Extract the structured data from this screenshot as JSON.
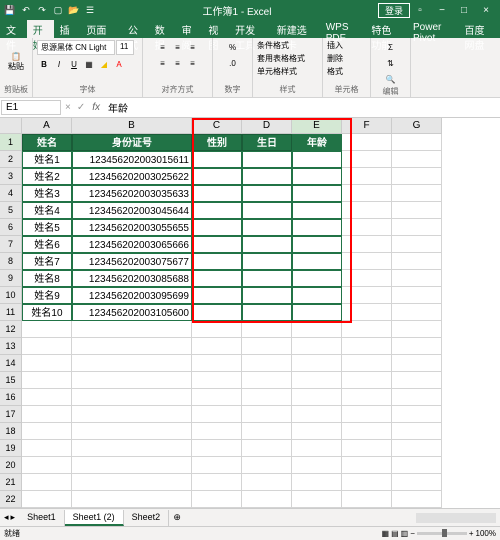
{
  "titlebar": {
    "title": "工作簿1 - Excel",
    "login": "登录",
    "qat": [
      "save-icon",
      "undo-icon",
      "redo-icon",
      "new-icon",
      "open-icon",
      "touch-icon"
    ]
  },
  "tabs": [
    "文件",
    "开始",
    "插入",
    "页面布局",
    "公式",
    "数据",
    "审阅",
    "视图",
    "开发工具",
    "新建选项卡",
    "WPS PDF",
    "特色功能",
    "Power Pivot",
    "百度网盘"
  ],
  "activeTab": 1,
  "ribbon": {
    "clipboard": {
      "label": "剪贴板",
      "paste": "粘贴"
    },
    "font": {
      "label": "字体",
      "name": "思源黑体 CN Light",
      "size": "11"
    },
    "align": {
      "label": "对齐方式"
    },
    "number": {
      "label": "数字"
    },
    "styles": {
      "label": "样式",
      "cond": "条件格式",
      "tbl": "套用表格格式",
      "cell": "单元格样式"
    },
    "cells": {
      "label": "单元格",
      "ins": "插入",
      "del": "删除",
      "fmt": "格式"
    },
    "edit": {
      "label": "编辑"
    }
  },
  "namebox": "E1",
  "formula": "年龄",
  "columns": [
    "A",
    "B",
    "C",
    "D",
    "E",
    "F",
    "G"
  ],
  "headers": {
    "A": "姓名",
    "B": "身份证号",
    "C": "性别",
    "D": "生日",
    "E": "年龄"
  },
  "rows": [
    {
      "n": "姓名1",
      "id": "123456202003015611"
    },
    {
      "n": "姓名2",
      "id": "123456202003025622"
    },
    {
      "n": "姓名3",
      "id": "123456202003035633"
    },
    {
      "n": "姓名4",
      "id": "123456202003045644"
    },
    {
      "n": "姓名5",
      "id": "123456202003055655"
    },
    {
      "n": "姓名6",
      "id": "123456202003065666"
    },
    {
      "n": "姓名7",
      "id": "123456202003075677"
    },
    {
      "n": "姓名8",
      "id": "123456202003085688"
    },
    {
      "n": "姓名9",
      "id": "123456202003095699"
    },
    {
      "n": "姓名10",
      "id": "123456202003105600"
    }
  ],
  "emptyRows": 12,
  "sheets": [
    "Sheet1",
    "Sheet1 (2)",
    "Sheet2"
  ],
  "activeSheet": 1,
  "status": {
    "ready": "就绪",
    "zoom": "100%"
  }
}
